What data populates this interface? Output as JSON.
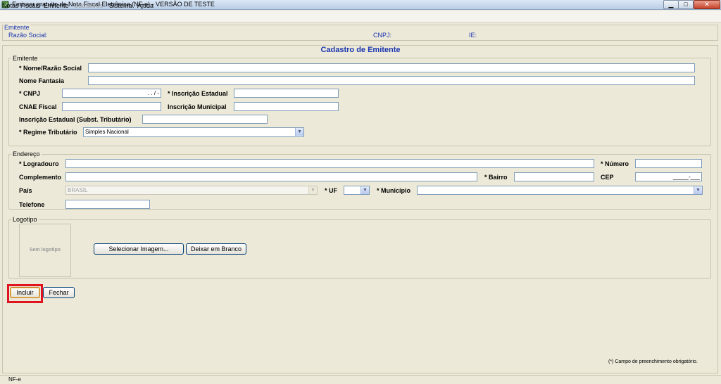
{
  "window": {
    "title": "Emissor gratuito de Nota Fiscal Eletrônica (NF-e) - VERSÃO DE TESTE",
    "minimize": "▁",
    "maximize": "□",
    "close": "✕"
  },
  "menu": {
    "items": [
      "Notas Fiscais",
      "Emitente",
      "Cadastros",
      "Sistema",
      "Ajuda"
    ]
  },
  "info": {
    "legend": "Emitente",
    "razao_social_label": "Razão Social:",
    "cnpj_label": "CNPJ:",
    "ie_label": "IE:"
  },
  "form": {
    "title": "Cadastro de Emitente",
    "emitente": {
      "legend": "Emitente",
      "nome_label": "* Nome/Razão Social",
      "nome_value": "",
      "fantasia_label": "Nome Fantasia",
      "fantasia_value": "",
      "cnpj_label": "* CNPJ",
      "cnpj_mask": ". .  /  -",
      "ie_label": "* Inscrição Estadual",
      "ie_value": "",
      "cnae_label": "CNAE Fiscal",
      "cnae_value": "",
      "im_label": "Inscrição Municipal",
      "im_value": "",
      "iest_label": "Inscrição Estadual (Subst. Tributário)",
      "iest_value": "",
      "regime_label": "* Regime Tributário",
      "regime_value": "Simples Nacional"
    },
    "endereco": {
      "legend": "Endereço",
      "logradouro_label": "* Logradouro",
      "logradouro_value": "",
      "numero_label": "* Número",
      "numero_value": "",
      "complemento_label": "Complemento",
      "complemento_value": "",
      "bairro_label": "* Bairro",
      "bairro_value": "",
      "cep_label": "CEP",
      "cep_mask": "_____-___",
      "pais_label": "País",
      "pais_value": "BRASIL",
      "uf_label": "* UF",
      "uf_value": "",
      "municipio_label": "* Município",
      "municipio_value": "",
      "telefone_label": "Telefone",
      "telefone_value": ""
    },
    "logotipo": {
      "legend": "Logotipo",
      "placeholder": "Sem logotipo",
      "select_button": "Selecionar Imagem...",
      "clear_button": "Deixar em Branco"
    },
    "buttons": {
      "incluir": "Incluir",
      "fechar": "Fechar"
    },
    "note": "(*) Campo de preenchimento obrigatório."
  },
  "status": {
    "text": "NF-e"
  },
  "colors": {
    "accent": "#1b36b0",
    "highlight": "#e0141e",
    "background": "#ece9d8"
  }
}
